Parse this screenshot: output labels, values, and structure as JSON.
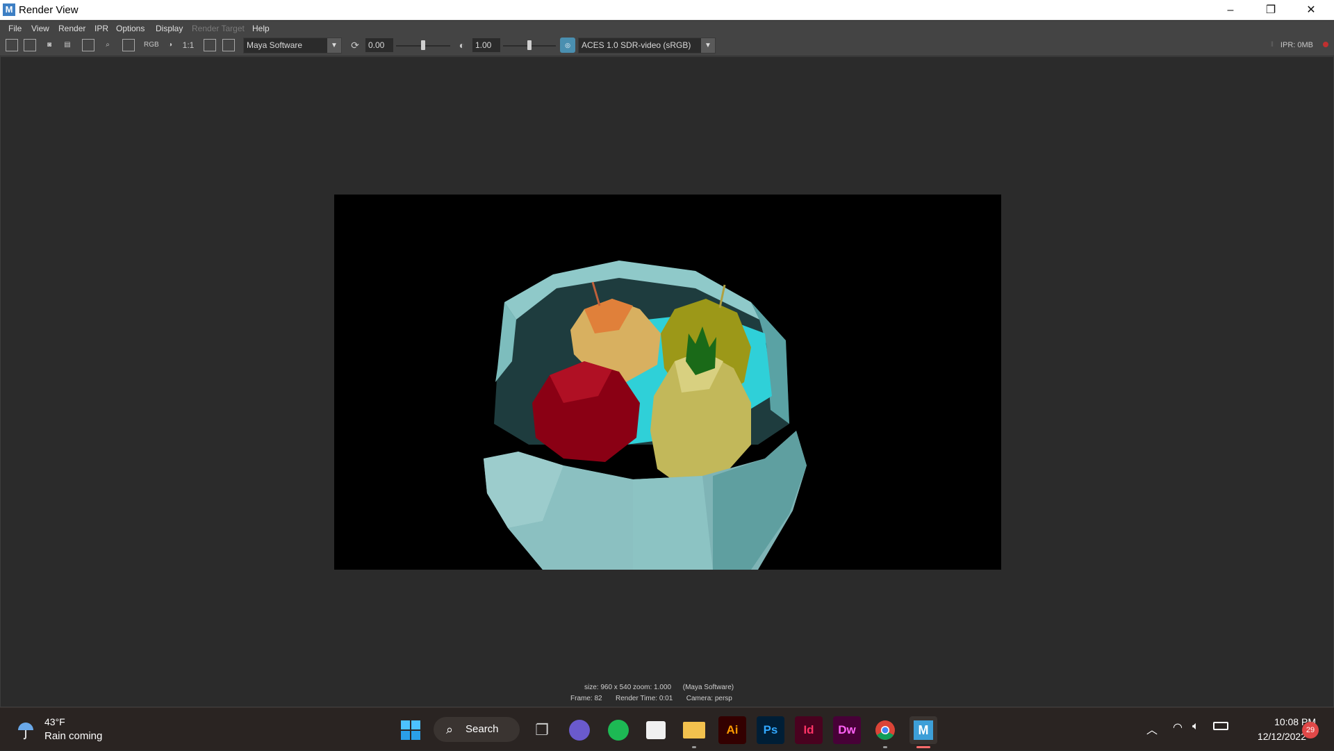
{
  "window": {
    "title": "Render View",
    "app_icon_letter": "M",
    "controls": {
      "minimize": "–",
      "restore": "❐",
      "close": "✕"
    }
  },
  "menubar": {
    "items": [
      {
        "label": "File",
        "enabled": true
      },
      {
        "label": "View",
        "enabled": true
      },
      {
        "label": "Render",
        "enabled": true
      },
      {
        "label": "IPR",
        "enabled": true
      },
      {
        "label": "Options",
        "enabled": true
      },
      {
        "label": "Display",
        "enabled": true
      },
      {
        "label": "Render Target",
        "enabled": false
      },
      {
        "label": "Help",
        "enabled": true
      }
    ]
  },
  "toolbar": {
    "rgb_label": "RGB",
    "one_to_one_label": "1:1",
    "renderer": "Maya Software",
    "exposure_value": "0.00",
    "gamma_value": "1.00",
    "exposure_fraction": 0.5,
    "gamma_fraction": 0.5,
    "view_transform": "ACES 1.0 SDR-video (sRGB)",
    "ipr_status": "IPR: 0MB"
  },
  "render": {
    "status_line1": "size: 960 x 540 zoom: 1.000      (Maya Software)",
    "status_line2": "Frame: 82       Render Time: 0:01       Camera: persp"
  },
  "taskbar": {
    "weather_temp": "43°F",
    "weather_desc": "Rain coming",
    "search_label": "Search",
    "apps": [
      {
        "name": "Start",
        "icon": "windows-icon"
      },
      {
        "name": "Task View",
        "icon": "task-view-icon"
      },
      {
        "name": "Teams Chat",
        "icon": "chat-icon"
      },
      {
        "name": "Spotify",
        "icon": "spotify-icon"
      },
      {
        "name": "Microsoft Store",
        "icon": "store-icon"
      },
      {
        "name": "File Explorer",
        "icon": "folder-icon"
      },
      {
        "name": "Illustrator",
        "label": "Ai",
        "icon": "illustrator-icon"
      },
      {
        "name": "Photoshop",
        "label": "Ps",
        "icon": "photoshop-icon"
      },
      {
        "name": "InDesign",
        "label": "Id",
        "icon": "indesign-icon"
      },
      {
        "name": "Dreamweaver",
        "label": "Dw",
        "icon": "dreamweaver-icon"
      },
      {
        "name": "Chrome",
        "icon": "chrome-icon"
      },
      {
        "name": "Maya",
        "label": "M",
        "icon": "maya-icon"
      }
    ],
    "time": "10:08 PM",
    "date": "12/12/2022",
    "notification_count": "29"
  }
}
